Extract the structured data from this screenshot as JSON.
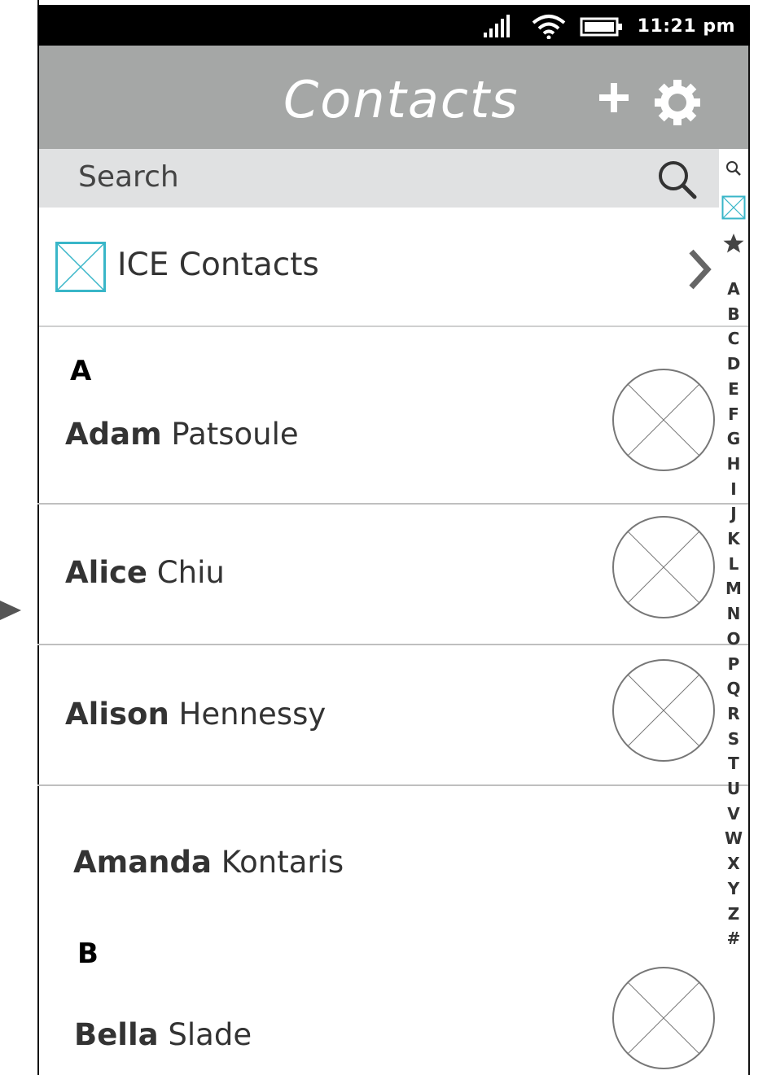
{
  "status_bar": {
    "time": "11:21 pm",
    "icons": [
      "signal-icon",
      "wifi-icon",
      "battery-icon"
    ]
  },
  "header": {
    "title": "Contacts",
    "actions": [
      "add-icon",
      "gear-icon"
    ]
  },
  "search": {
    "placeholder": "Search"
  },
  "ice": {
    "label": "ICE Contacts"
  },
  "sections": [
    {
      "letter": "A"
    },
    {
      "letter": "B"
    }
  ],
  "contacts": [
    {
      "first": "Adam",
      "last": " Patsoule"
    },
    {
      "first": "Alice",
      "last": " Chiu"
    },
    {
      "first": "Alison",
      "last": " Hennessy"
    },
    {
      "first": "Amanda",
      "last": " Kontaris"
    },
    {
      "first": "Bella",
      "last": " Slade"
    }
  ],
  "index": {
    "letters": [
      "A",
      "B",
      "C",
      "D",
      "E",
      "F",
      "G",
      "H",
      "I",
      "J",
      "K",
      "L",
      "M",
      "N",
      "O",
      "P",
      "Q",
      "R",
      "S",
      "T",
      "U",
      "V",
      "W",
      "X",
      "Y",
      "Z",
      "#"
    ]
  },
  "colors": {
    "header_bg": "#a5a7a6",
    "search_bg": "#e0e1e2",
    "accent_placeholder": "#39b6c8"
  }
}
